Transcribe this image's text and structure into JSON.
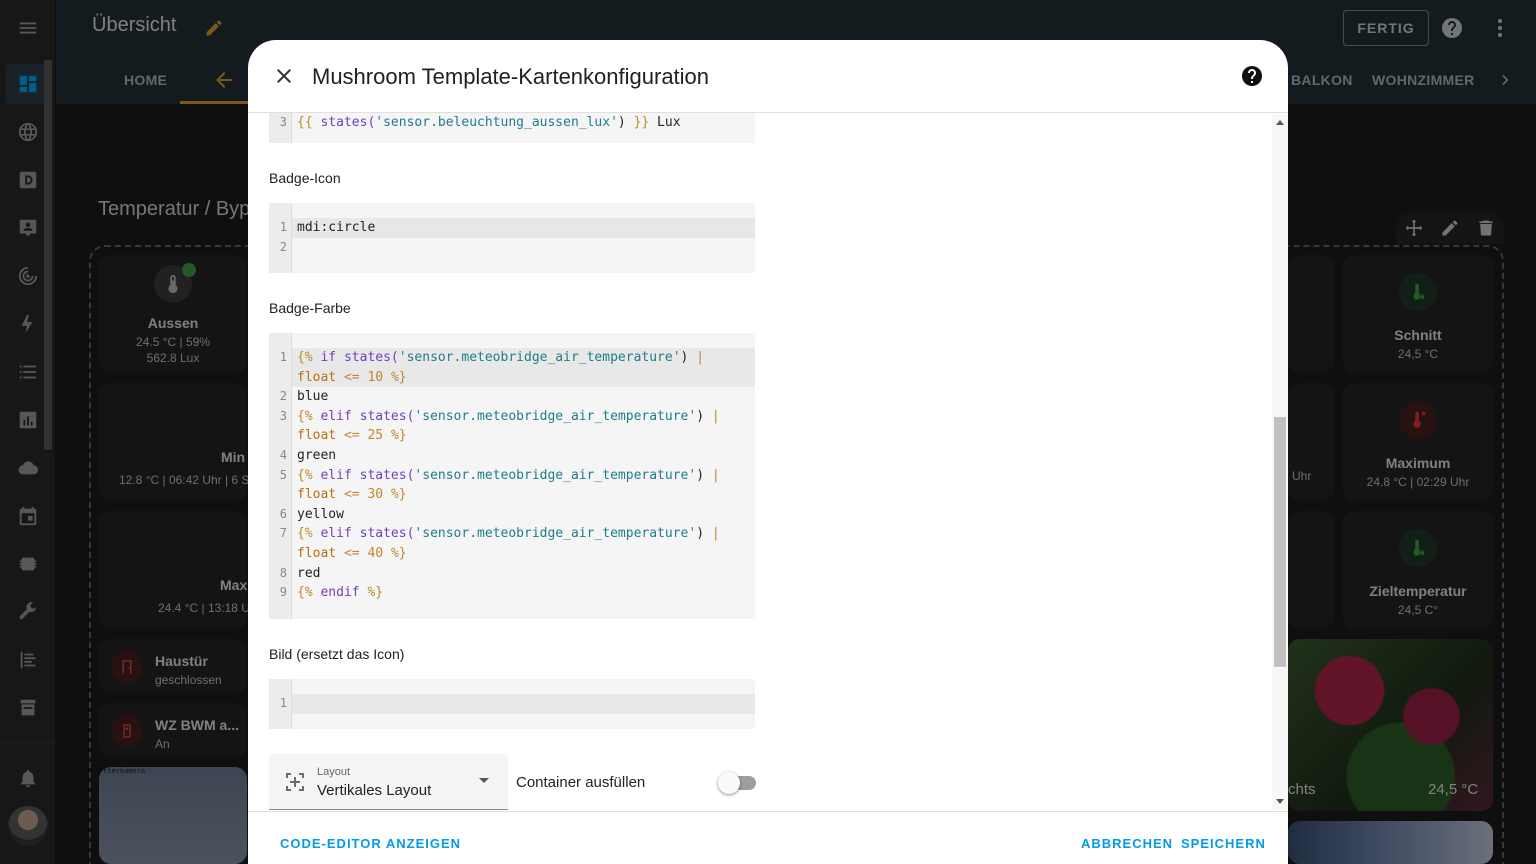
{
  "header": {
    "title": "Übersicht",
    "done_label": "FERTIG",
    "tabs": [
      "HOME",
      "BALKON",
      "WOHNZIMMER"
    ]
  },
  "dashboard": {
    "section_title": "Temperatur / Byp",
    "cards_left": [
      {
        "name": "Aussen",
        "sub1": "24.5 °C | 59%",
        "sub2": "562.8 Lux"
      },
      {
        "name": "Min",
        "sub1": "12.8 °C | 06:42 Uhr | 6 S"
      },
      {
        "name": "Max",
        "sub1": "24.4 °C | 13:18 U"
      }
    ],
    "cards_right": [
      {
        "name": "Schnitt",
        "sub1": "24,5 °C"
      },
      {
        "name": "Maximum",
        "sub1": "24.8 °C | 02:29 Uhr"
      },
      {
        "name": "Zieltemperatur",
        "sub1": "24,5 C°"
      }
    ],
    "mid_fragment": "Uhr",
    "small_cards": [
      {
        "name": "Haustür",
        "sub": "geschlossen"
      },
      {
        "name": "WZ BWM a...",
        "sub": "An"
      }
    ],
    "photo_left_label": "tterkamera",
    "photo_right_label": "chts",
    "photo_right_value": "24,5 °C"
  },
  "dialog": {
    "title": "Mushroom Template-Kartenkonfiguration",
    "fields": {
      "badge_icon_label": "Badge-Icon",
      "badge_color_label": "Badge-Farbe",
      "image_label": "Bild (ersetzt das Icon)"
    },
    "code_top": {
      "line3_num": "3",
      "line3_a": "{{ ",
      "line3_fn": "states(",
      "line3_str": "'sensor.beleuchtung_aussen_lux'",
      "line3_b": ") ",
      "line3_c": "}}",
      "line3_d": " Lux"
    },
    "code_icon": {
      "line1": "mdi:circle"
    },
    "code_color": {
      "sensor": "'sensor.meteobridge_air_temperature'",
      "colors": [
        "blue",
        "green",
        "yellow",
        "red"
      ],
      "thresholds": [
        "10",
        "25",
        "30",
        "40"
      ],
      "kw_if": "if",
      "kw_elif": "elif",
      "kw_endif": "endif",
      "fn": "states(",
      "filter": "float"
    },
    "layout": {
      "label": "Layout",
      "value": "Vertikales Layout"
    },
    "container_fill_label": "Container ausfüllen",
    "footer": {
      "code_editor": "CODE-EDITOR ANZEIGEN",
      "cancel": "ABBRECHEN",
      "save": "SPEICHERN"
    }
  },
  "colors": {
    "accent": "#e6a12e",
    "link": "#039be5",
    "header_bg": "#263238"
  }
}
